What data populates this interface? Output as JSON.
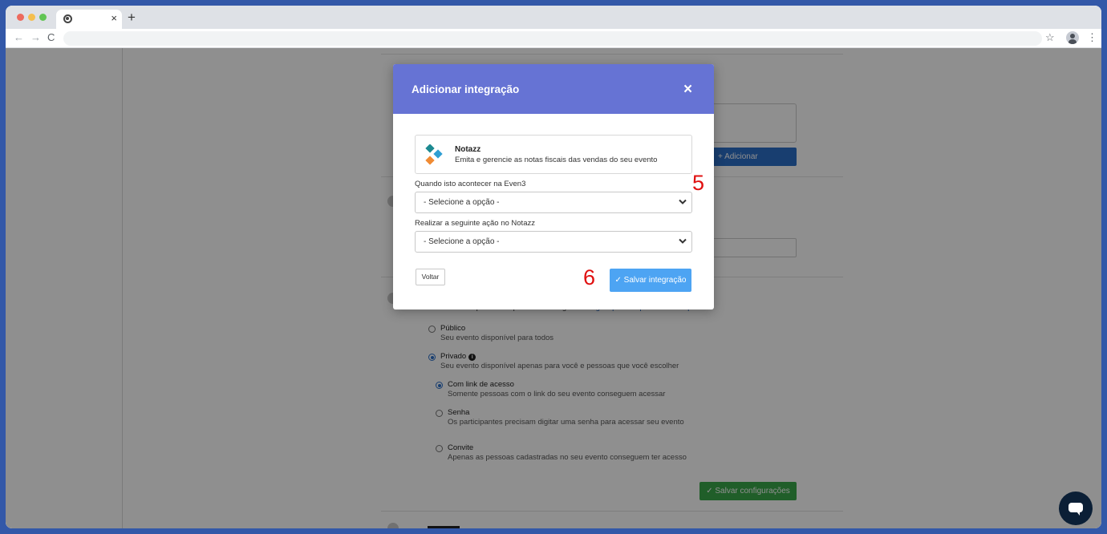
{
  "browser": {
    "tab_close": "×",
    "new_tab": "+",
    "back": "←",
    "forward": "→",
    "reload": "C",
    "bookmark": "☆",
    "menu": "⋮"
  },
  "background_page": {
    "add_integration_button": "+ Adicionar integração",
    "privacy_description_start": "Seu evento é público ou privado? Configure ",
    "privacy_description_link": "configurações de privacidade aqui",
    "privacy_options": [
      {
        "title": "Público",
        "desc": "Seu evento disponível para todos",
        "checked": false
      },
      {
        "title": "Privado",
        "desc": "Seu evento disponível apenas para você e pessoas que você escolher",
        "checked": true
      }
    ],
    "private_suboptions": [
      {
        "title": "Com link de acesso",
        "desc": "Somente pessoas com o link do seu evento conseguem acessar",
        "checked": true
      },
      {
        "title": "Senha",
        "desc": "Os participantes precisam digitar uma senha para acessar seu evento",
        "checked": false
      },
      {
        "title": "Convite",
        "desc": "Apenas as pessoas cadastradas no seu evento conseguem ter acesso",
        "checked": false
      }
    ],
    "save_settings_button": "✓ Salvar configurações"
  },
  "modal": {
    "title": "Adicionar integração",
    "close": "×",
    "integration": {
      "name": "Notazz",
      "description": "Emita e gerencie as notas fiscais das vendas do seu evento"
    },
    "trigger_label": "Quando isto acontecer na Even3",
    "trigger_value": "- Selecione a opção -",
    "action_label": "Realizar a seguinte ação no Notazz",
    "action_value": "- Selecione a opção -",
    "back_button": "Voltar",
    "save_button": "✓ Salvar integração"
  },
  "annotations": {
    "step_5": "5",
    "step_6": "6",
    "color": "#e01010"
  },
  "colors": {
    "modal_header": "#6673d4",
    "save_button": "#4da4f3",
    "overlay_frame": "#3358a8"
  }
}
